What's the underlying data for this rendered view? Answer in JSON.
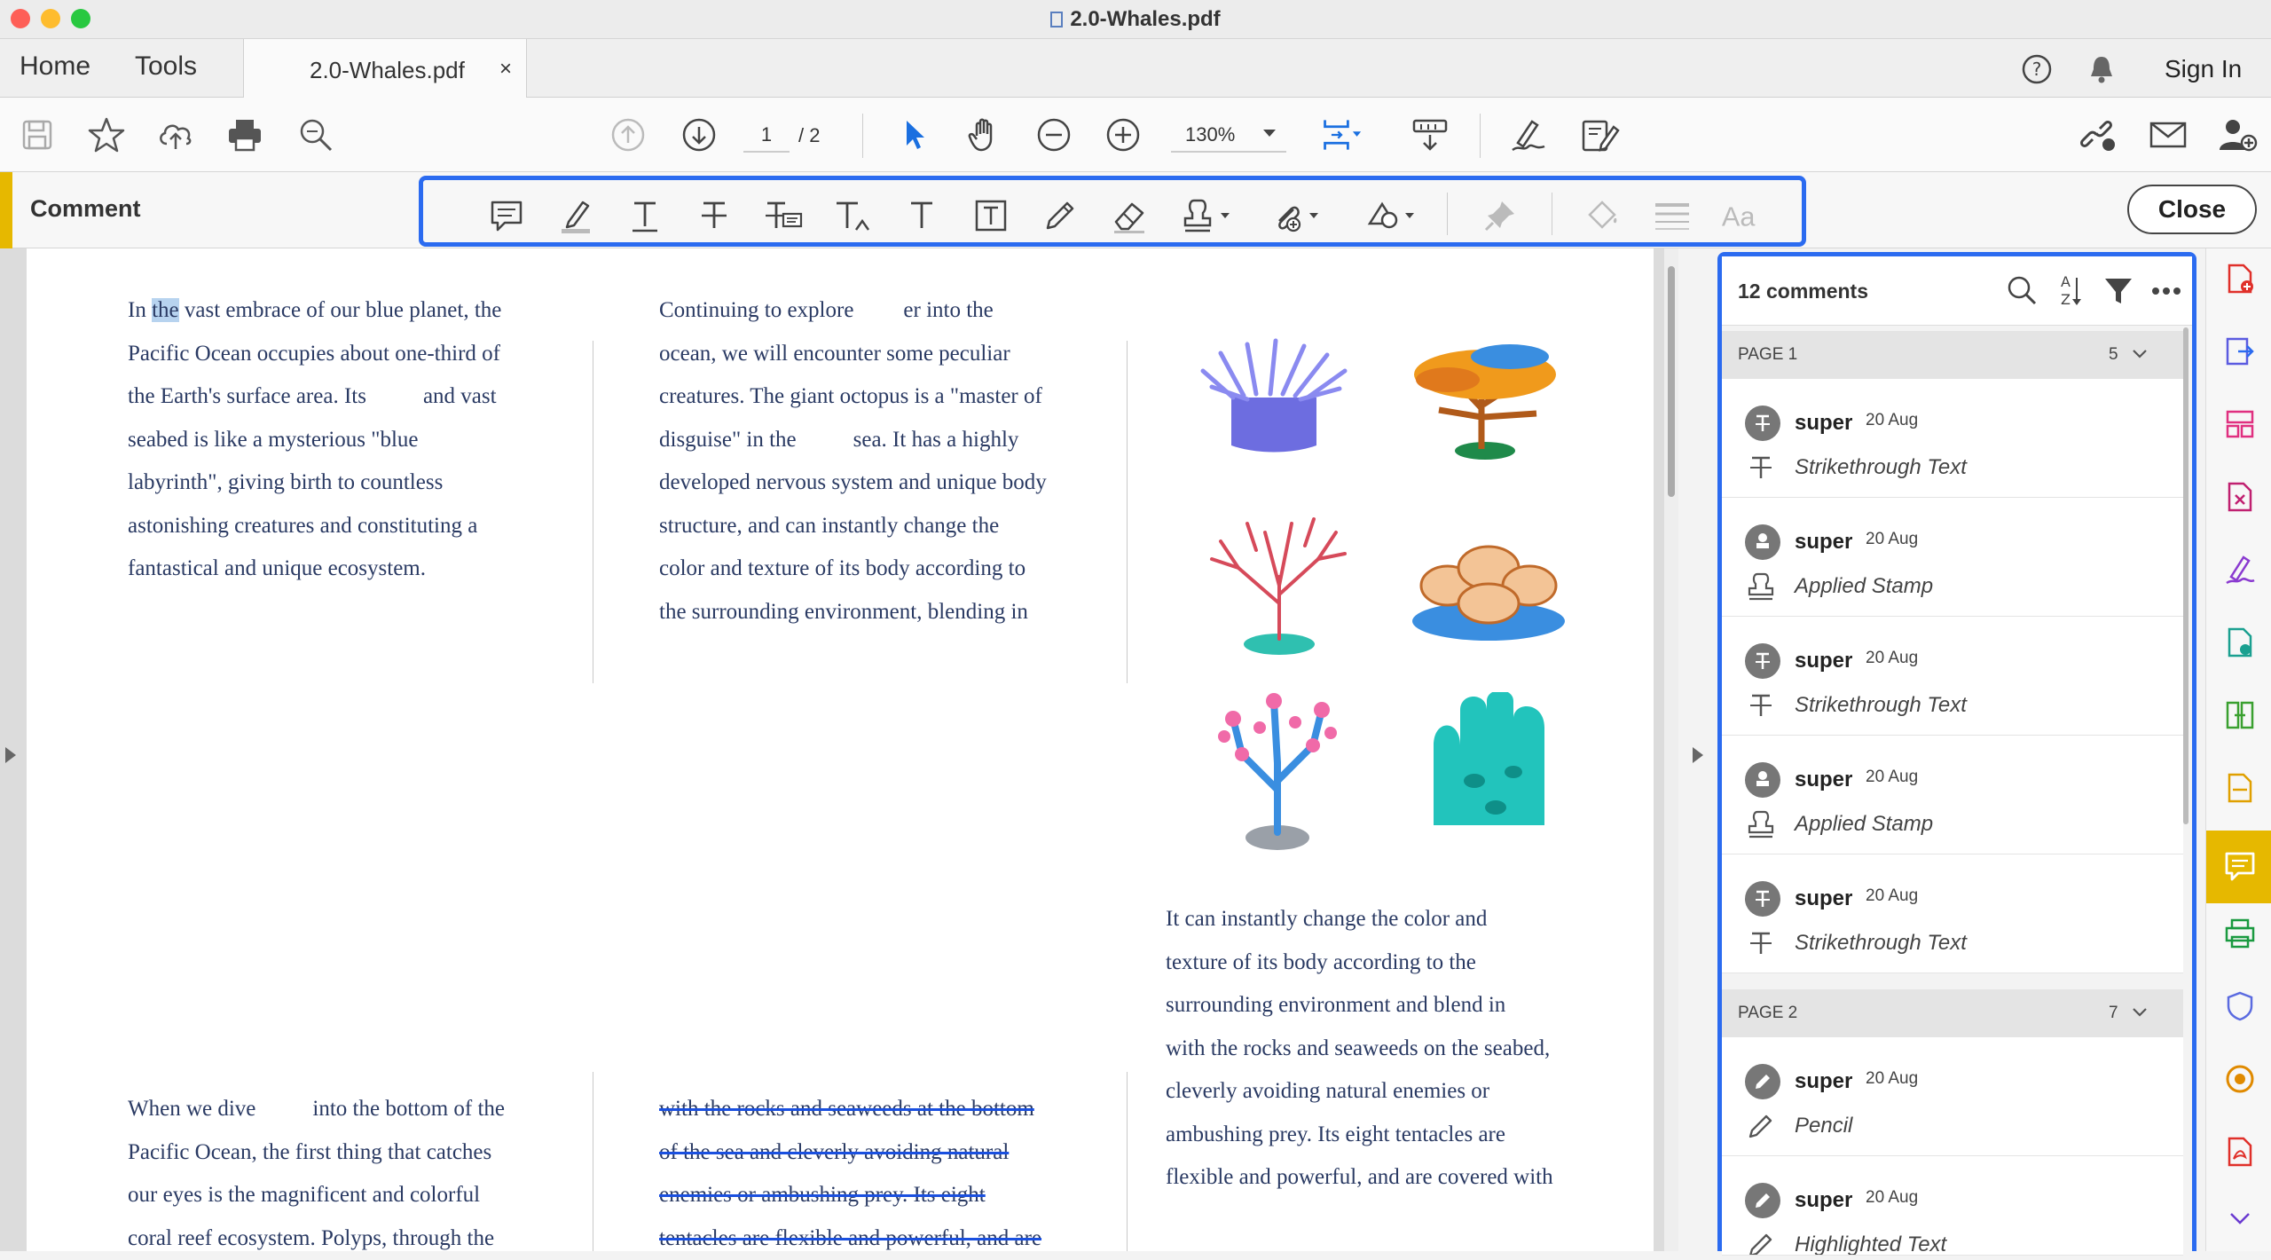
{
  "window": {
    "title": "2.0-Whales.pdf"
  },
  "tabs": {
    "home": "Home",
    "tools": "Tools",
    "document": "2.0-Whales.pdf",
    "close_glyph": "×"
  },
  "header": {
    "sign_in": "Sign In"
  },
  "toolbar": {
    "page_current": "1",
    "page_total": "/ 2",
    "zoom": "130%"
  },
  "comment_bar": {
    "label": "Comment",
    "close": "Close"
  },
  "document": {
    "col1_top": "In the vast embrace of our blue planet, the Pacific Ocean occupies about one-third of the Earth's surface area. Its and vast seabed is like a mysterious \"blue labyrinth\", giving birth to countless astonishing creatures and constituting a fantastical and unique ecosystem.",
    "col1_top_lines": [
      "In",
      "the",
      "vast embrace of our blue planet, the",
      "Pacific Ocean occupies about one-third of",
      "the Earth's surface area. Its",
      "and vast",
      "seabed is like a mysterious \"blue",
      "labyrinth\", giving birth to countless",
      "astonishing creatures and constituting a",
      "fantastical and unique ecosystem."
    ],
    "col2_top_lines": [
      "Continuing to explore",
      "er into the",
      "ocean, we will encounter some peculiar",
      "creatures. The giant octopus is a \"master of",
      "disguise\" in the",
      "sea. It has a highly",
      "developed nervous system and unique body",
      "structure, and can instantly change the",
      "color and texture of its body according to",
      "the surrounding environment, blending in"
    ],
    "col3_lines": [
      "It can instantly change the color and",
      "texture of its body according to the",
      "surrounding environment and blend in",
      "with the rocks and seaweeds on the seabed,",
      "cleverly avoiding natural enemies or",
      "ambushing prey. Its eight tentacles are",
      "flexible and powerful, and are covered with"
    ],
    "col1_bottom_lines": [
      "When we dive",
      "into the bottom of the",
      "Pacific Ocean, the first thing that catches",
      "our eyes is the magnificent and colorful",
      "coral reef ecosystem. Polyps, through the"
    ],
    "col2_bottom_lines": [
      "with the rocks and seaweeds at the bottom",
      "of the sea and cleverly avoiding natural",
      "enemies or ambushing prey. Its eight",
      "tentacles are flexible and powerful, and are"
    ]
  },
  "comments_panel": {
    "count_label": "12 comments",
    "groups": [
      {
        "label": "PAGE 1",
        "count": "5",
        "items": [
          {
            "author": "super",
            "date": "20 Aug",
            "type": "Strikethrough Text"
          },
          {
            "author": "super",
            "date": "20 Aug",
            "type": "Applied Stamp"
          },
          {
            "author": "super",
            "date": "20 Aug",
            "type": "Strikethrough Text"
          },
          {
            "author": "super",
            "date": "20 Aug",
            "type": "Applied Stamp"
          },
          {
            "author": "super",
            "date": "20 Aug",
            "type": "Strikethrough Text"
          }
        ]
      },
      {
        "label": "PAGE 2",
        "count": "7",
        "items": [
          {
            "author": "super",
            "date": "20 Aug",
            "type": "Pencil"
          },
          {
            "author": "super",
            "date": "20 Aug",
            "type": "Highlighted Text"
          }
        ]
      }
    ]
  },
  "colors": {
    "accent_blue": "#2b6bf0",
    "comment_yellow": "#e6b800",
    "text_navy": "#2a3a63",
    "highlight": "#b7d3ef"
  }
}
